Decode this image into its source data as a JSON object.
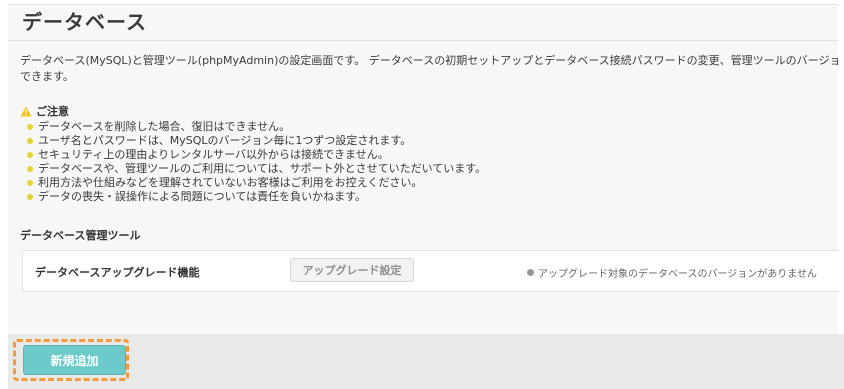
{
  "page": {
    "title": "データベース",
    "description": "データベース(MySQL)と管理ツール(phpMyAdmin)の設定画面です。 データベースの初期セットアップとデータベース接続パスワードの変更、管理ツールのバージョンアップが",
    "description_cont": "できます。"
  },
  "notice": {
    "heading": "ご注意",
    "items": [
      "データベースを削除した場合、復旧はできません。",
      "ユーザ名とパスワードは、MySQLのバージョン毎に1つずつ設定されます。",
      "セキュリティ上の理由よりレンタルサーバ以外からは接続できません。",
      "データベースや、管理ツールのご利用については、サポート外とさせていただいています。",
      "利用方法や仕組みなどを理解されていないお客様はご利用をお控えください。",
      "データの喪失・誤操作による問題については責任を負いかねます。"
    ]
  },
  "tools": {
    "section_heading": "データベース管理ツール",
    "row": {
      "label": "データベースアップグレード機能",
      "button_label": "アップグレード設定",
      "status": "アップグレード対象のデータベースのバージョンがありません"
    }
  },
  "footer": {
    "add_button_label": "新規追加"
  },
  "colors": {
    "accent": "#6ccacb",
    "highlight": "#f29a3c",
    "notice_bullet": "#e4d43a",
    "warning": "#f0c419"
  }
}
